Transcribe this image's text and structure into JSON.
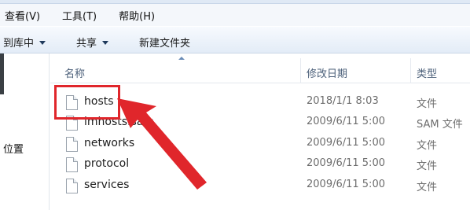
{
  "menubar": {
    "items": [
      "查看(V)",
      "工具(T)",
      "帮助(H)"
    ]
  },
  "toolbar": {
    "library": "到库中",
    "share": "共享",
    "new_folder": "新建文件夹"
  },
  "columns": {
    "name": "名称",
    "modified": "修改日期",
    "type": "类型"
  },
  "sidebar": {
    "location": "位置"
  },
  "files": [
    {
      "name": "hosts",
      "modified": "2018/1/1 8:03",
      "type": "文件"
    },
    {
      "name": "lmhosts.sam",
      "modified": "2009/6/11 5:00",
      "type": "SAM 文件"
    },
    {
      "name": "networks",
      "modified": "2009/6/11 5:00",
      "type": "文件"
    },
    {
      "name": "protocol",
      "modified": "2009/6/11 5:00",
      "type": "文件"
    },
    {
      "name": "services",
      "modified": "2009/6/11 5:00",
      "type": "文件"
    }
  ],
  "annotation": {
    "color": "#e0262b"
  }
}
